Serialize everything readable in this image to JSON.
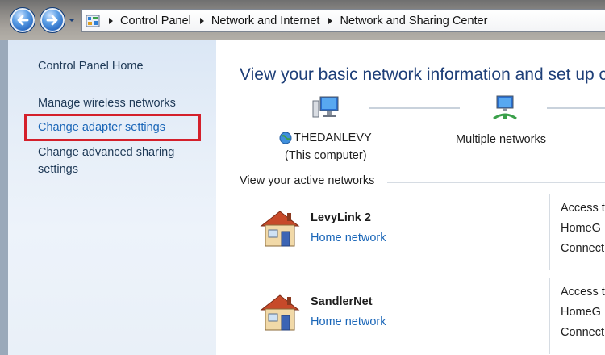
{
  "address_bar": {
    "crumbs": [
      "Control Panel",
      "Network and Internet",
      "Network and Sharing Center"
    ]
  },
  "left_pane": {
    "home": "Control Panel Home",
    "wireless": "Manage wireless networks",
    "adapter": "Change adapter settings",
    "advanced": "Change advanced sharing settings"
  },
  "main": {
    "title": "View your basic network information and set up co",
    "map": {
      "computer_name": "THEDANLEVY",
      "computer_sub": "(This computer)",
      "networks_label": "Multiple networks"
    },
    "active_header": "View your active networks",
    "networks": [
      {
        "name": "LevyLink  2",
        "type": "Home network",
        "side": [
          "Access t",
          "HomeG",
          "Connect"
        ]
      },
      {
        "name": "SandlerNet",
        "type": "Home network",
        "side": [
          "Access t",
          "HomeG",
          "Connect"
        ]
      }
    ]
  },
  "colors": {
    "highlight": "#d4202b",
    "link": "#1a66b8",
    "title": "#1e3f78"
  }
}
